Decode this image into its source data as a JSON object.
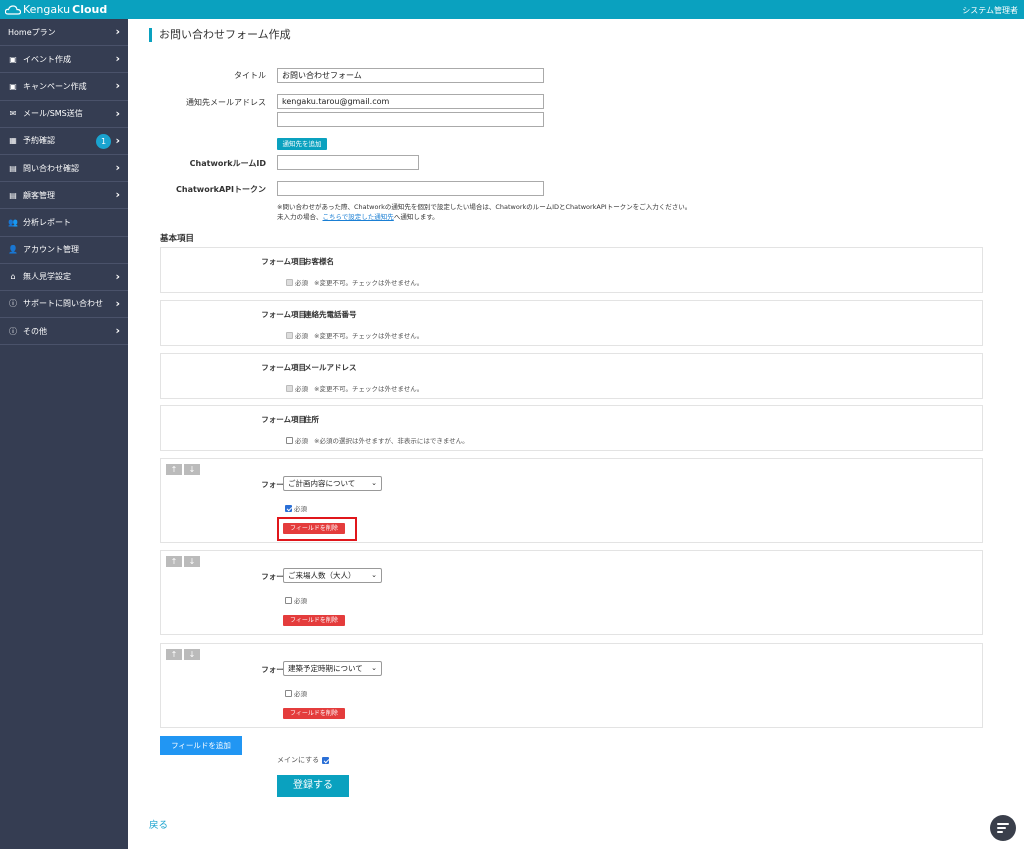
{
  "header": {
    "logo_prefix": "Kengaku",
    "logo_suffix": "Cloud",
    "user": "システム管理者"
  },
  "sidebar": {
    "items": [
      {
        "label": "Homeプラン",
        "icon": "none",
        "chevron": true
      },
      {
        "label": "イベント作成",
        "icon": "image-icon",
        "chevron": true
      },
      {
        "label": "キャンペーン作成",
        "icon": "image-icon",
        "chevron": true
      },
      {
        "label": "メール/SMS送信",
        "icon": "envelope-icon",
        "chevron": true
      },
      {
        "label": "予約確認",
        "icon": "calendar-icon",
        "chevron": true,
        "badge": "1"
      },
      {
        "label": "問い合わせ確認",
        "icon": "id-card-icon",
        "chevron": true
      },
      {
        "label": "顧客管理",
        "icon": "id-card-icon",
        "chevron": true
      },
      {
        "label": "分析レポート",
        "icon": "users-icon",
        "chevron": false
      },
      {
        "label": "アカウント管理",
        "icon": "user-gear-icon",
        "chevron": false
      },
      {
        "label": "無人見学設定",
        "icon": "home-icon",
        "chevron": true
      },
      {
        "label": "サポートに問い合わせ",
        "icon": "info-icon",
        "chevron": true
      },
      {
        "label": "その他",
        "icon": "info-icon",
        "chevron": true
      }
    ]
  },
  "page": {
    "title": "お問い合わせフォーム作成",
    "form": {
      "title_label": "タイトル",
      "title_value": "お問い合わせフォーム",
      "email_label": "通知先メールアドレス",
      "email_value_1": "kengaku.tarou@gmail.com",
      "email_value_2": "",
      "add_email_button": "通知先を追加",
      "chatwork_room_label": "ChatworkルームID",
      "chatwork_room_value": "",
      "chatwork_token_label": "ChatworkAPIトークン",
      "chatwork_token_value": "",
      "note_line_1": "※問い合わせがあった際、Chatworkの通知先を個別で設定したい場合は、ChatworkのルームIDとChatworkAPIトークンをご入力ください。",
      "note_line_2_pre": "未入力の場合、",
      "note_line_2_link": "こちらで設定した通知先",
      "note_line_2_post": "へ通知します。"
    },
    "basic_section_title": "基本項目",
    "item_key": "フォーム項目",
    "required_label": "必須",
    "fixed_fields": [
      {
        "name": "お客様名",
        "note": "※変更不可。チェックは外せません。",
        "disabled": true
      },
      {
        "name": "連絡先電話番号",
        "note": "※変更不可。チェックは外せません。",
        "disabled": true
      },
      {
        "name": "メールアドレス",
        "note": "※変更不可。チェックは外せません。",
        "disabled": true
      },
      {
        "name": "住所",
        "note": "※必須の選択は外せますが、非表示にはできません。",
        "disabled": false
      }
    ],
    "custom_fields": [
      {
        "select": "ご計画内容について",
        "required": true
      },
      {
        "select": "ご来場人数（大人）",
        "required": false
      },
      {
        "select": "建築予定時期について",
        "required": false
      }
    ],
    "arrow_up": "↑",
    "arrow_down": "↓",
    "delete_button": "フィールドを削除",
    "add_field_button": "フィールドを追加",
    "main_checkbox_label": "メインにする",
    "submit_button": "登録する",
    "back_link": "戻る"
  }
}
